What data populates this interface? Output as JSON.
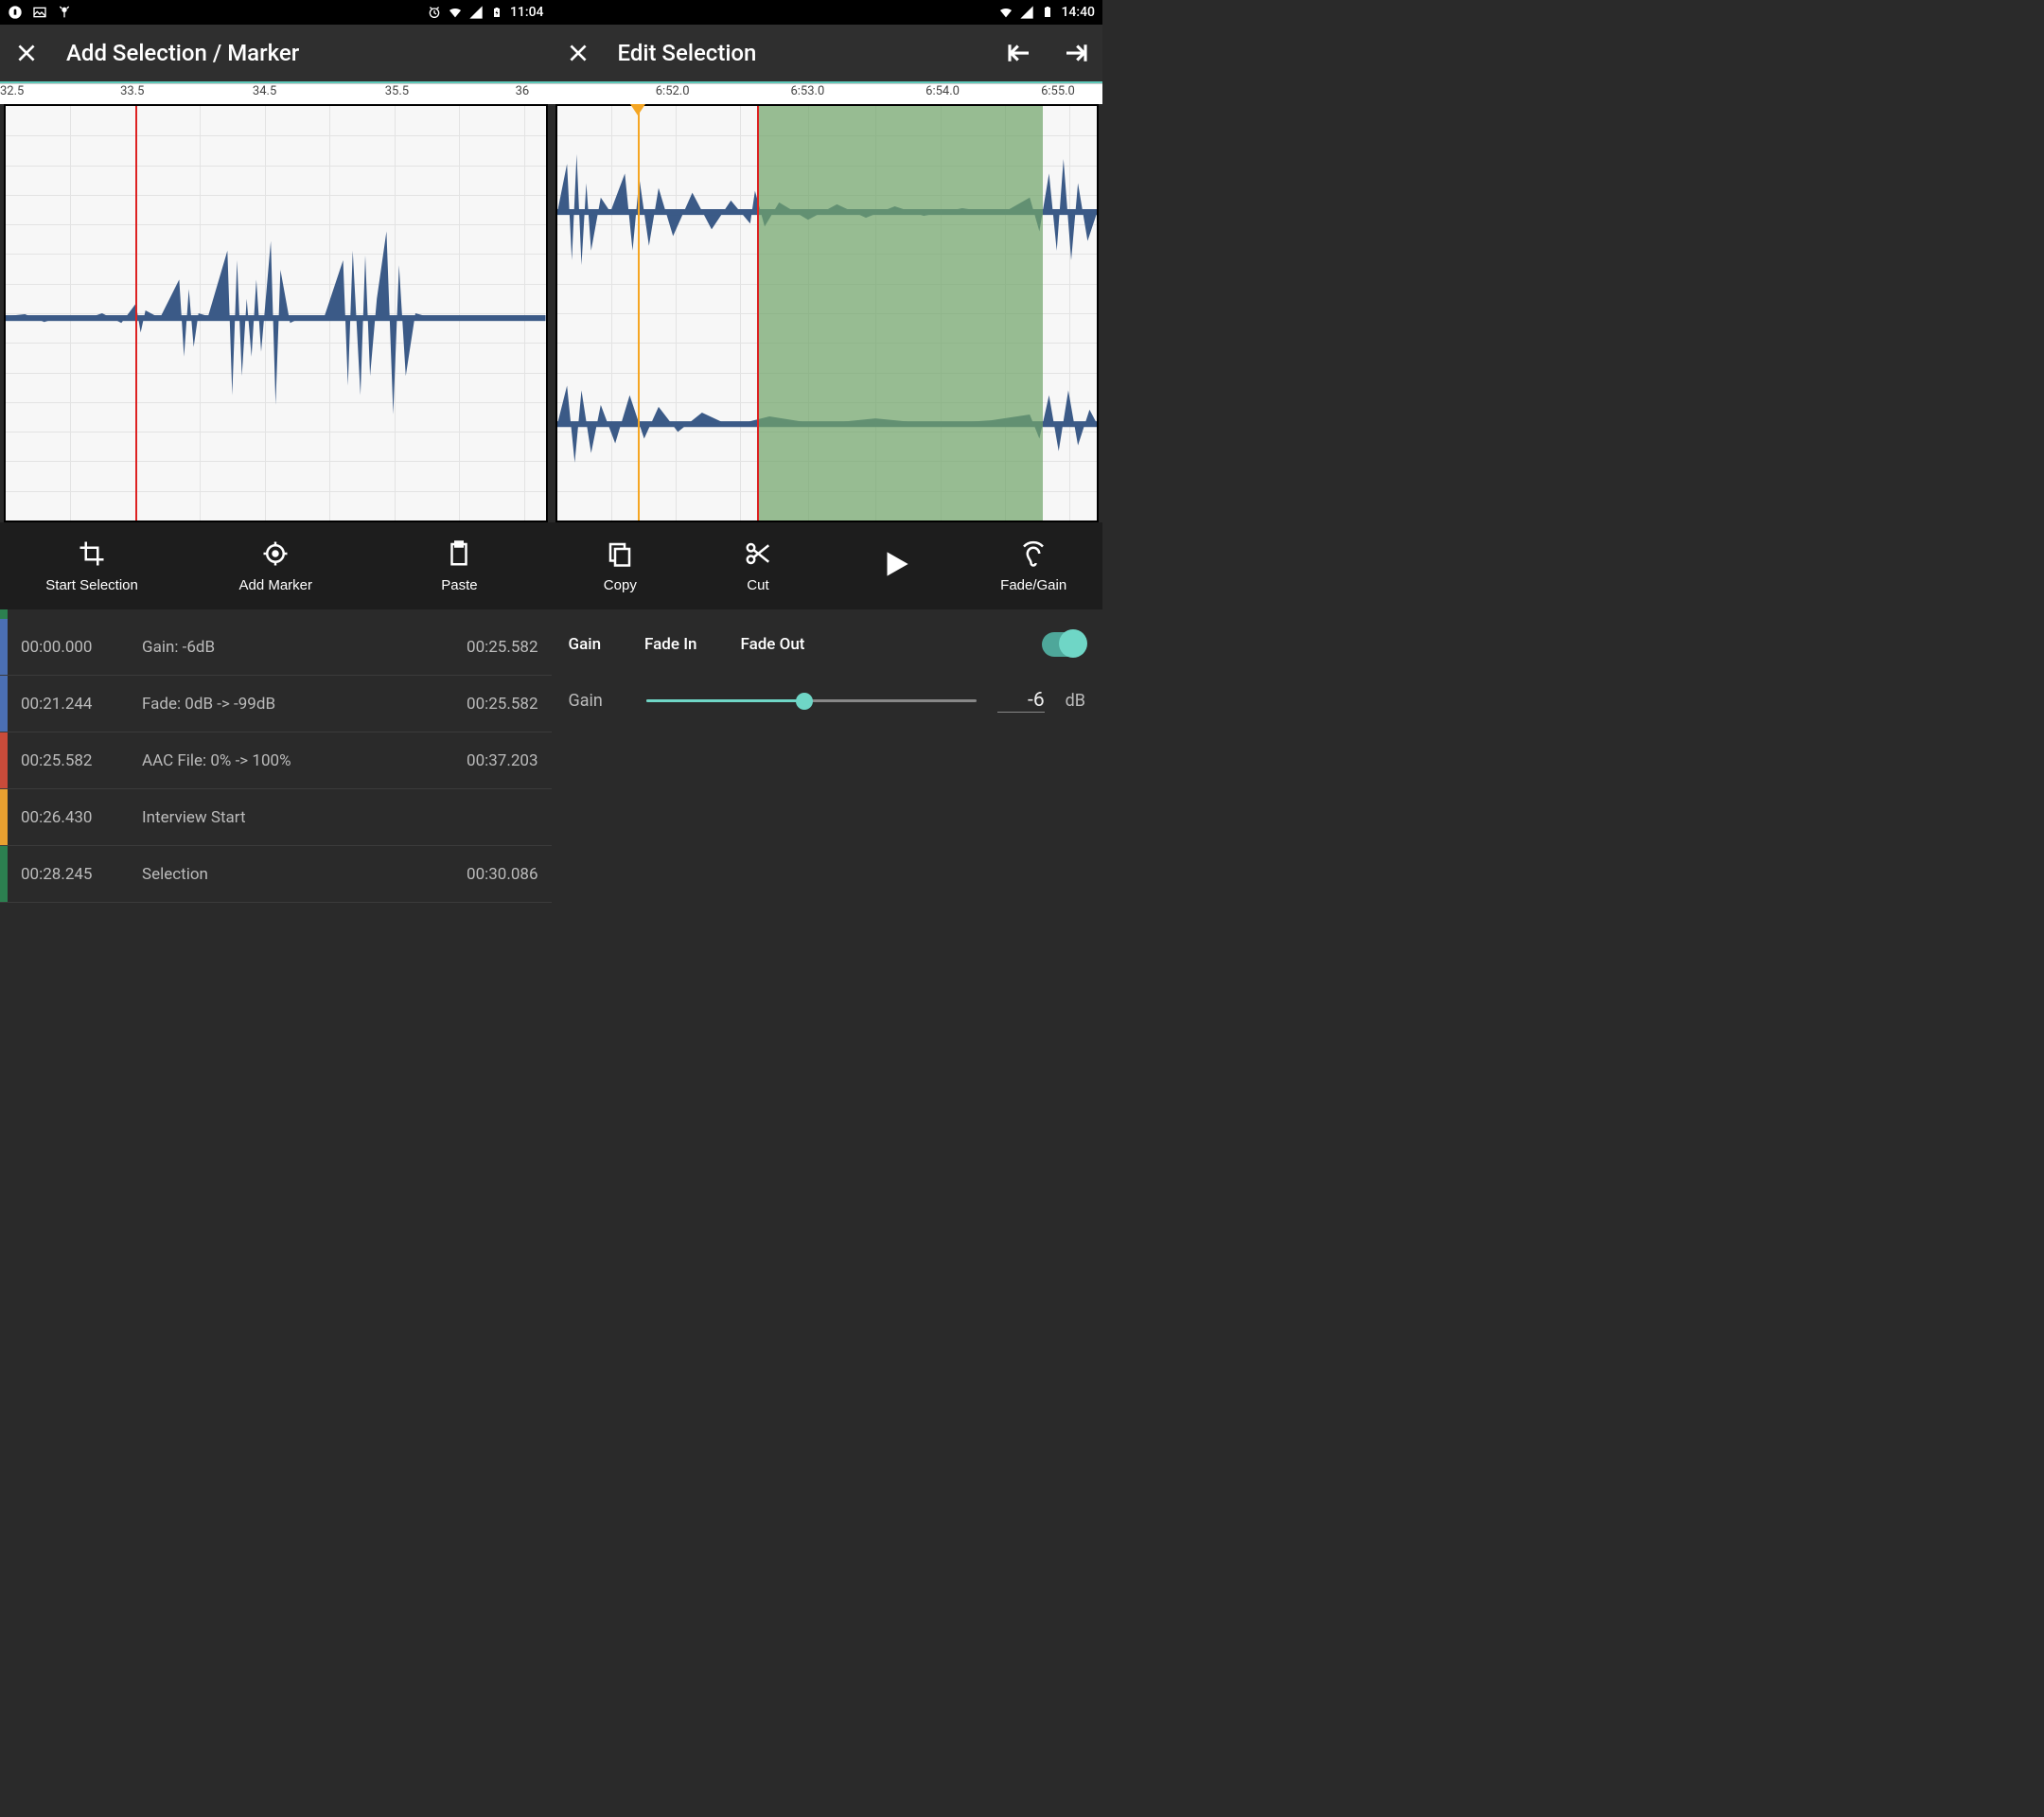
{
  "left": {
    "status": {
      "time": "11:04"
    },
    "toolbar": {
      "title": "Add Selection / Marker"
    },
    "ruler": [
      "32.5",
      "33.5",
      "34.5",
      "35.5",
      "36"
    ],
    "ruler_pos": [
      0,
      24,
      48,
      72,
      96
    ],
    "cursor_pct": 24,
    "actions": {
      "start": "Start Selection",
      "marker": "Add Marker",
      "paste": "Paste"
    },
    "rows": [
      {
        "color": "#4b6fb3",
        "start": "00:00.000",
        "desc": "Gain: -6dB",
        "end": "00:25.582"
      },
      {
        "color": "#4b6fb3",
        "start": "00:21.244",
        "desc": "Fade: 0dB -> -99dB",
        "end": "00:25.582"
      },
      {
        "color": "#c94b3a",
        "start": "00:25.582",
        "desc": "AAC File: 0% -> 100%",
        "end": "00:37.203"
      },
      {
        "color": "#e8a030",
        "start": "00:26.430",
        "desc": "Interview Start",
        "end": ""
      },
      {
        "color": "#2c8050",
        "start": "00:28.245",
        "desc": "Selection",
        "end": "00:30.086"
      }
    ],
    "cut_color": "#2c8050"
  },
  "right": {
    "status": {
      "time": "14:40"
    },
    "toolbar": {
      "title": "Edit Selection"
    },
    "ruler": [
      "6:52.0",
      "6:53.0",
      "6:54.0",
      "6:55.0"
    ],
    "ruler_pos": [
      22,
      46.5,
      71,
      95
    ],
    "marker_pct": 15,
    "cursor_pct": 37,
    "sel_start_pct": 37,
    "sel_end_pct": 90,
    "actions": {
      "copy": "Copy",
      "cut": "Cut",
      "fadegain": "Fade/Gain"
    },
    "fade": {
      "tabs": {
        "gain": "Gain",
        "fadein": "Fade In",
        "fadeout": "Fade Out"
      },
      "label": "Gain",
      "value": "-6",
      "unit": "dB",
      "slider_pct": 48
    }
  }
}
